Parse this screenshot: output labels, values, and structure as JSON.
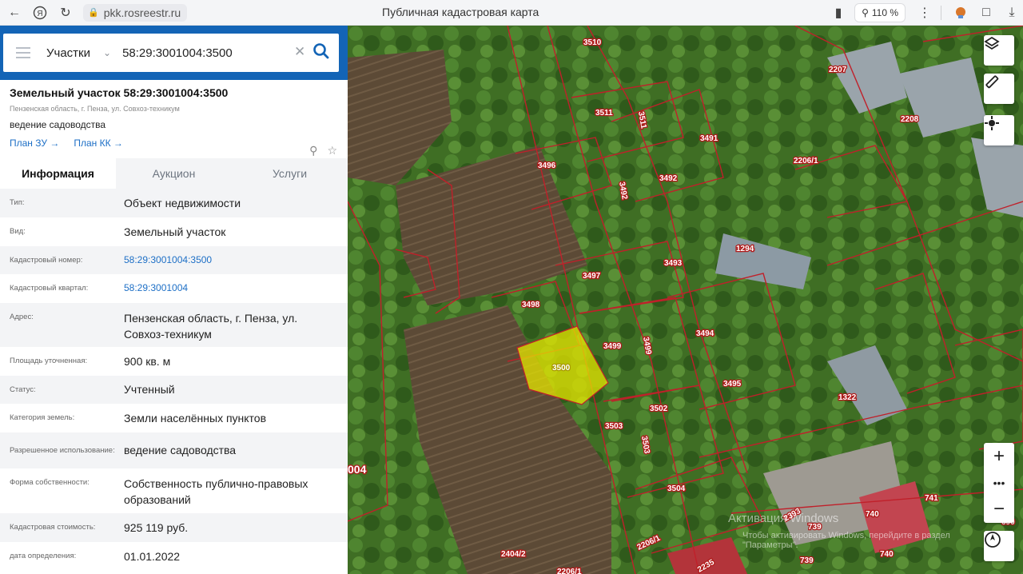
{
  "browser": {
    "url": "pkk.rosreestr.ru",
    "tab_title": "Публичная кадастровая карта",
    "zoom": "110 %",
    "icons": [
      "back-icon",
      "yandex-icon",
      "reload-icon",
      "lock-icon",
      "bookmark-icon",
      "zoom-magnifier-icon",
      "more-icon",
      "extension-icon",
      "reading-mode-icon",
      "download-icon"
    ]
  },
  "search": {
    "type_label": "Участки",
    "query": "58:29:3001004:3500"
  },
  "object": {
    "title": "Земельный участок 58:29:3001004:3500",
    "address_small": "Пензенская область, г. Пенза, ул. Совхоз-техникум",
    "use": "ведение садоводства",
    "link_plan_zu": "План ЗУ →",
    "link_plan_kk": "План КК →"
  },
  "tabs": [
    {
      "label": "Информация",
      "active": true
    },
    {
      "label": "Аукцион",
      "active": false
    },
    {
      "label": "Услуги",
      "active": false
    }
  ],
  "info_rows": [
    {
      "key": "Тип:",
      "value": "Объект недвижимости"
    },
    {
      "key": "Вид:",
      "value": "Земельный участок"
    },
    {
      "key": "Кадастровый номер:",
      "value": "58:29:3001004:3500",
      "link": true
    },
    {
      "key": "Кадастровый квартал:",
      "value": "58:29:3001004",
      "link": true
    },
    {
      "key": "Адрес:",
      "value": "Пензенская область, г. Пенза, ул. Совхоз-техникум"
    },
    {
      "key": "Площадь уточненная:",
      "value": "900 кв. м"
    },
    {
      "key": "Статус:",
      "value": "Учтенный"
    },
    {
      "key": "Категория земель:",
      "value": "Земли населённых пунктов"
    },
    {
      "key": "Разрешенное использование:",
      "value": "ведение садоводства"
    },
    {
      "key": "Форма собственности:",
      "value": "Собственность публично-правовых образований"
    },
    {
      "key": "Кадастровая стоимость:",
      "value": "925 119 руб."
    },
    {
      "key": "дата определения:",
      "value": "01.01.2022"
    }
  ],
  "map": {
    "parcel_labels": [
      "3510",
      "3511",
      "3511",
      "3491",
      "3492",
      "3492",
      "3496",
      "1294",
      "3493",
      "3497",
      "3498",
      "3494",
      "3499",
      "3499",
      "3500",
      "3495",
      "3502",
      "3503",
      "3503",
      "3504",
      "2207",
      "2208",
      "2206/1",
      "1322",
      "2393",
      "739",
      "740",
      "741",
      "690",
      "740",
      "739",
      "2404/2",
      "2206/1",
      "2206/1",
      "2235",
      "004"
    ],
    "highlight_parcel": "3500",
    "boundary_color": "#c0202a",
    "highlight_color": "#e6e600",
    "watermark_title": "Активация Windows",
    "watermark_text": "Чтобы активировать Windows, перейдите в раздел \"Параметры\"."
  }
}
